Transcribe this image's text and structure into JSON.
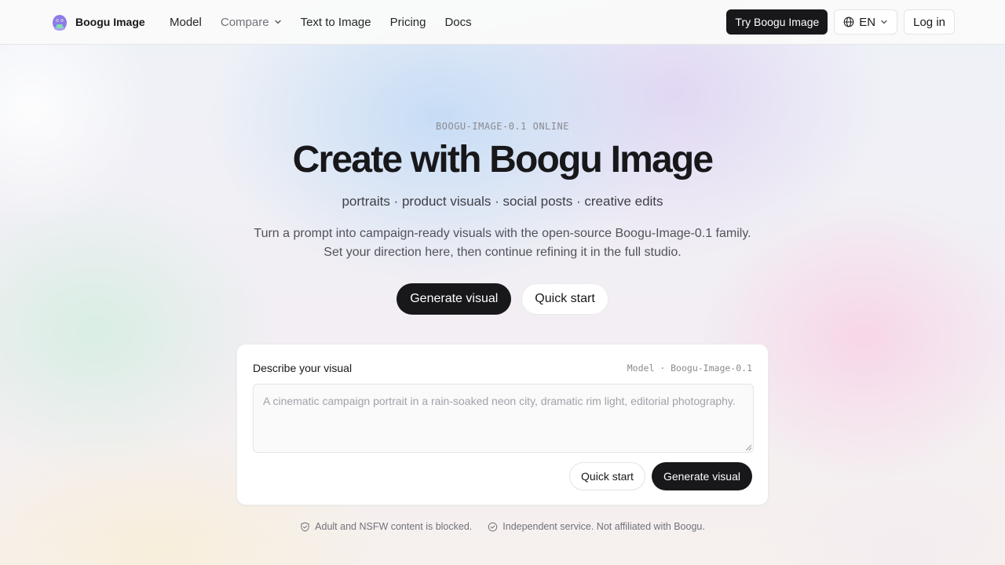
{
  "header": {
    "brand": "Boogu Image",
    "logo_icon": "purple-mascot-icon",
    "nav": [
      {
        "label": "Model",
        "muted": false,
        "dropdown": false
      },
      {
        "label": "Compare",
        "muted": true,
        "dropdown": true
      },
      {
        "label": "Text to Image",
        "muted": false,
        "dropdown": false
      },
      {
        "label": "Pricing",
        "muted": false,
        "dropdown": false
      },
      {
        "label": "Docs",
        "muted": false,
        "dropdown": false
      }
    ],
    "try_button": "Try Boogu Image",
    "language": "EN",
    "login": "Log in"
  },
  "hero": {
    "eyebrow": "BOOGU-IMAGE-0.1 ONLINE",
    "title": "Create with Boogu Image",
    "tags": "portraits · product visuals · social posts · creative edits",
    "description": "Turn a prompt into campaign-ready visuals with the open-source Boogu-Image-0.1 family. Set your direction here, then continue refining it in the full studio.",
    "primary_button": "Generate visual",
    "secondary_button": "Quick start"
  },
  "composer": {
    "label": "Describe your visual",
    "model": "Model · Boogu-Image-0.1",
    "prompt_value": "",
    "prompt_placeholder": "A cinematic campaign portrait in a rain-soaked neon city, dramatic rim light, editorial photography.",
    "quick_start": "Quick start",
    "generate": "Generate visual"
  },
  "footnotes": [
    {
      "icon": "shield-check-icon",
      "text": "Adult and NSFW content is blocked."
    },
    {
      "icon": "circle-check-icon",
      "text": "Independent service. Not affiliated with Boogu."
    }
  ],
  "colors": {
    "primary": "#18181b",
    "accent_logo": "#8b7be8"
  }
}
